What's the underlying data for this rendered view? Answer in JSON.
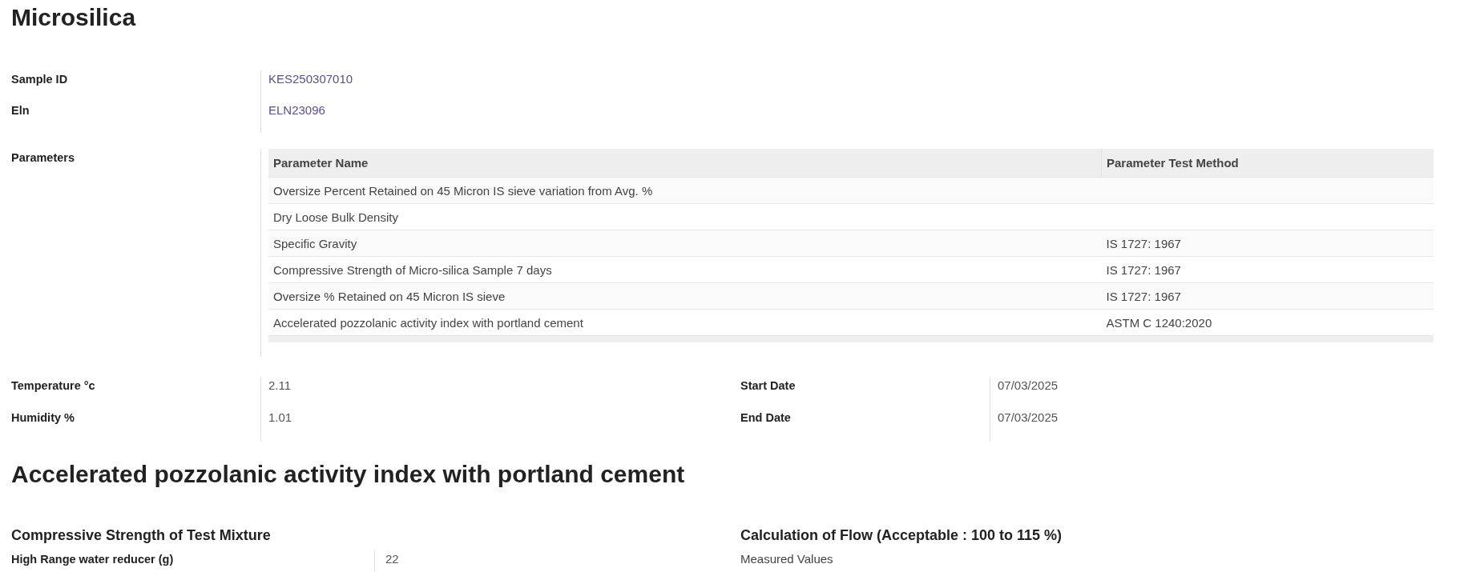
{
  "title": "Microsilica",
  "info": [
    {
      "label": "Sample ID",
      "value": "KES250307010"
    },
    {
      "label": "Eln",
      "value": "ELN23096"
    }
  ],
  "parameters": {
    "label": "Parameters",
    "columns": [
      "Parameter Name",
      "Parameter Test Method"
    ],
    "rows": [
      [
        "Oversize Percent Retained on 45 Micron IS sieve variation from Avg. %",
        ""
      ],
      [
        "Dry Loose Bulk Density",
        ""
      ],
      [
        "Specific Gravity",
        "IS 1727: 1967"
      ],
      [
        "Compressive Strength of Micro-silica Sample 7 days",
        "IS 1727: 1967"
      ],
      [
        "Oversize % Retained on 45 Micron IS sieve",
        "IS 1727: 1967"
      ],
      [
        "Accelerated pozzolanic activity index with portland cement",
        "ASTM C 1240:2020"
      ]
    ]
  },
  "conditions_left": [
    {
      "label": "Temperature °c",
      "value": "2.11"
    },
    {
      "label": "Humidity %",
      "value": "1.01"
    }
  ],
  "conditions_right": [
    {
      "label": "Start Date",
      "value": "07/03/2025"
    },
    {
      "label": "End Date",
      "value": "07/03/2025"
    }
  ],
  "section": {
    "title": "Accelerated pozzolanic activity index with portland cement",
    "left": {
      "heading": "Compressive Strength of Test Mixture",
      "label": "High Range water reducer (g)",
      "value": "22"
    },
    "right": {
      "heading": "Calculation of Flow (Acceptable : 100 to 115 %)",
      "text": "Measured Values"
    }
  }
}
